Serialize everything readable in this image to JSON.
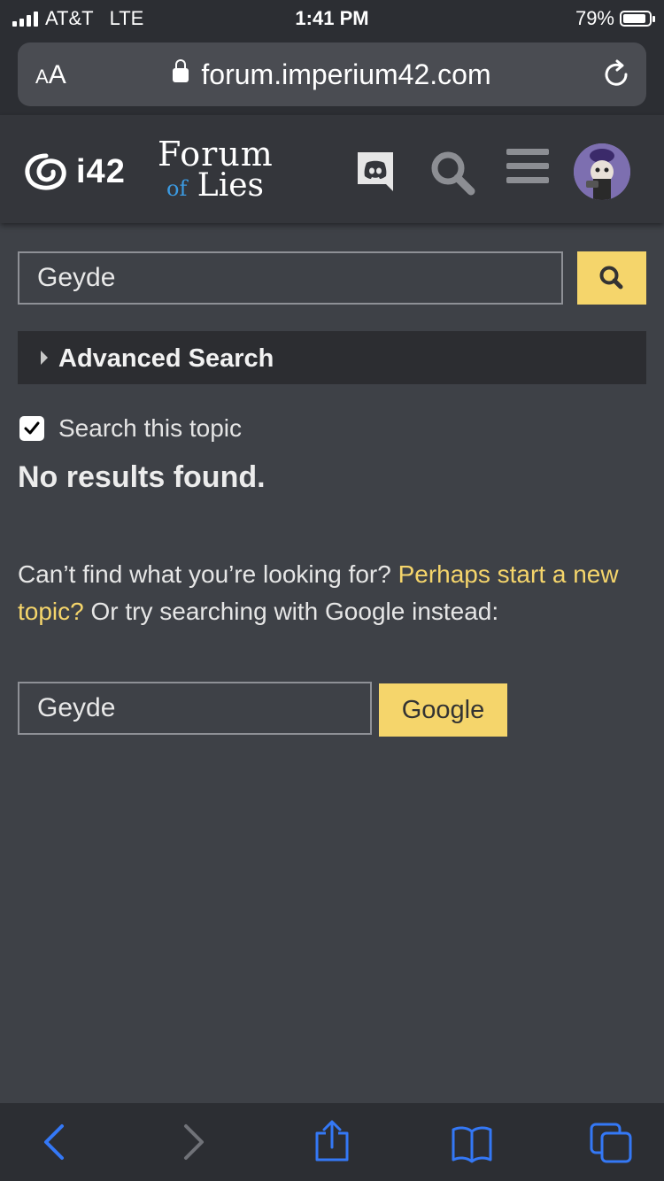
{
  "status": {
    "carrier": "AT&T",
    "network": "LTE",
    "time": "1:41 PM",
    "battery": "79%",
    "battery_level": 0.79
  },
  "browser": {
    "text_size_label": "AA",
    "url": "forum.imperium42.com"
  },
  "header": {
    "logo_text": "i42",
    "forum_line1": "Forum",
    "forum_of": "of",
    "forum_line2": "Lies"
  },
  "search": {
    "query": "Geyde",
    "advanced_label": "Advanced Search",
    "topic_label": "Search this topic",
    "topic_checked": true
  },
  "results": {
    "message": "No results found.",
    "help_prefix": "Can’t find what you’re looking for?",
    "help_link": "Perhaps start a new topic?",
    "help_suffix": "Or try searching with Google instead:"
  },
  "google": {
    "query": "Geyde",
    "button": "Google"
  },
  "colors": {
    "accent": "#f5d56b",
    "background": "#3e4147",
    "ios_blue": "#3478f6"
  }
}
